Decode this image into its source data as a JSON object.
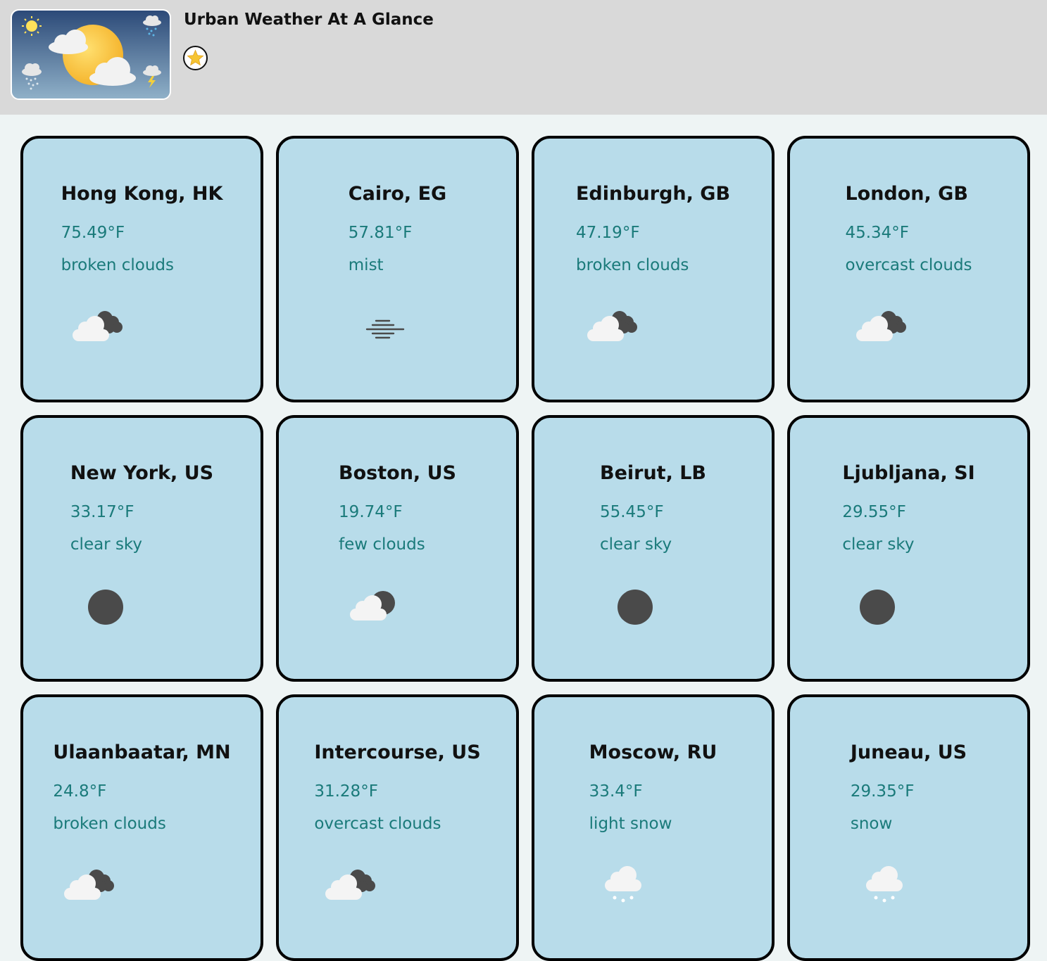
{
  "header": {
    "title": "Urban Weather At A Glance",
    "logo_icon": "weather-collage-icon",
    "favorite_icon": "star-icon",
    "star_color": "#f6c432"
  },
  "colors": {
    "header_bg": "#d9d9d9",
    "page_bg": "#eef4f4",
    "card_bg": "#b8dcea",
    "accent_text": "#1a7a7a"
  },
  "cards": [
    {
      "city": "Hong Kong, HK",
      "temp": "75.49°F",
      "desc": "broken clouds",
      "icon": "broken-clouds-icon"
    },
    {
      "city": "Cairo, EG",
      "temp": "57.81°F",
      "desc": "mist",
      "icon": "mist-icon"
    },
    {
      "city": "Edinburgh, GB",
      "temp": "47.19°F",
      "desc": "broken clouds",
      "icon": "broken-clouds-icon"
    },
    {
      "city": "London, GB",
      "temp": "45.34°F",
      "desc": "overcast clouds",
      "icon": "broken-clouds-icon"
    },
    {
      "city": "New York, US",
      "temp": "33.17°F",
      "desc": "clear sky",
      "icon": "clear-night-icon"
    },
    {
      "city": "Boston, US",
      "temp": "19.74°F",
      "desc": "few clouds",
      "icon": "few-clouds-night-icon"
    },
    {
      "city": "Beirut, LB",
      "temp": "55.45°F",
      "desc": "clear sky",
      "icon": "clear-night-icon"
    },
    {
      "city": "Ljubljana, SI",
      "temp": "29.55°F",
      "desc": "clear sky",
      "icon": "clear-night-icon"
    },
    {
      "city": "Ulaanbaatar, MN",
      "temp": "24.8°F",
      "desc": "broken clouds",
      "icon": "broken-clouds-icon"
    },
    {
      "city": "Intercourse, US",
      "temp": "31.28°F",
      "desc": "overcast clouds",
      "icon": "broken-clouds-icon"
    },
    {
      "city": "Moscow, RU",
      "temp": "33.4°F",
      "desc": "light snow",
      "icon": "snow-icon"
    },
    {
      "city": "Juneau, US",
      "temp": "29.35°F",
      "desc": "snow",
      "icon": "snow-icon"
    }
  ]
}
